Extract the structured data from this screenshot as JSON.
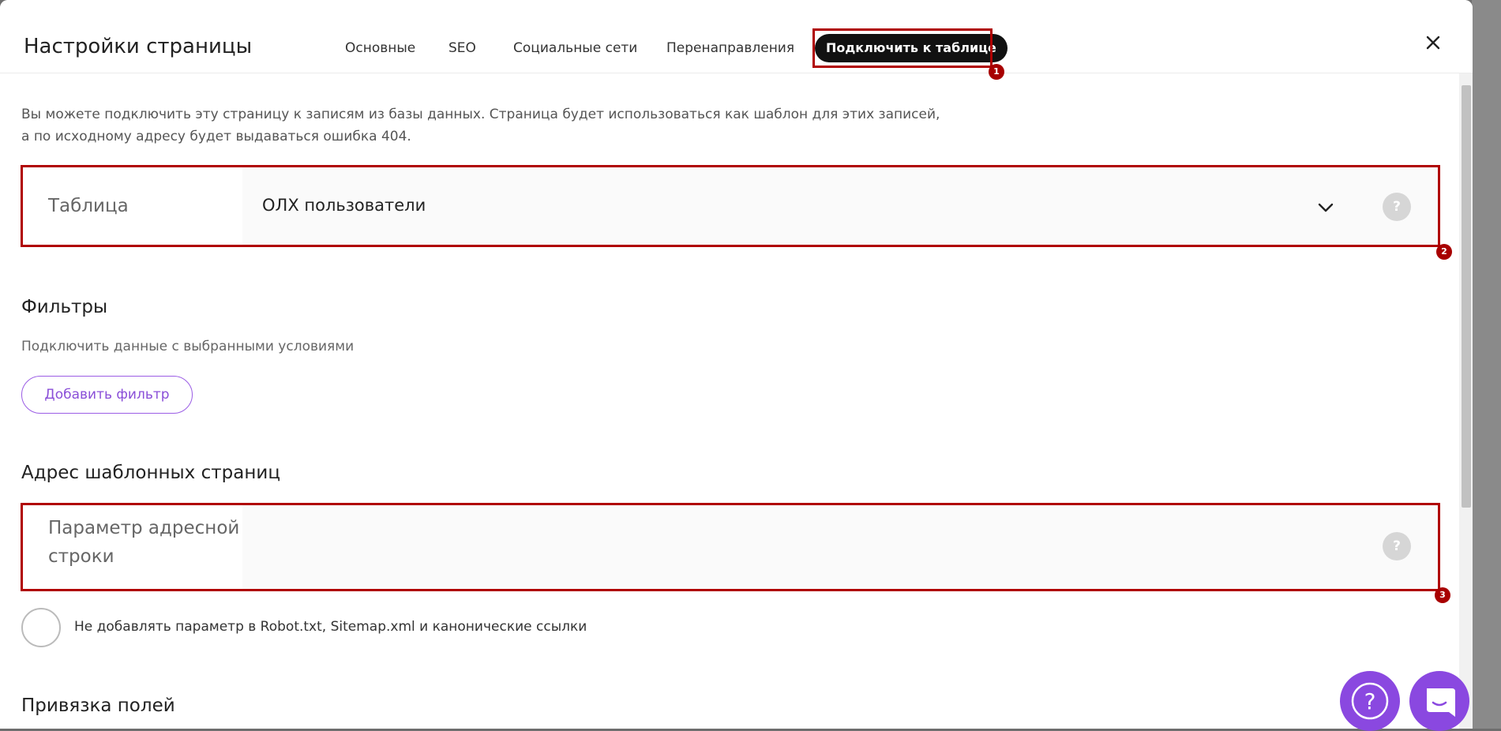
{
  "header": {
    "title": "Настройки страницы",
    "tabs": [
      {
        "label": "Основные"
      },
      {
        "label": "SEO"
      },
      {
        "label": "Социальные сети"
      },
      {
        "label": "Перенаправления"
      },
      {
        "label": "Подключить к таблице",
        "active": true
      }
    ],
    "close_icon": "close-icon"
  },
  "intro": {
    "line1": "Вы можете подключить эту страницу к записям из базы данных. Страница будет использоваться как шаблон для этих записей,",
    "line2": "а по исходному адресу будет выдаваться ошибка 404."
  },
  "table_field": {
    "label": "Таблица",
    "value": "ОЛХ пользователи",
    "help": "?"
  },
  "filters": {
    "title": "Фильтры",
    "subtitle": "Подключить данные с выбранными условиями",
    "add_button": "Добавить фильтр"
  },
  "template_address": {
    "title": "Адрес шаблонных страниц",
    "param_label_line1": "Параметр адресной",
    "param_label_line2": "строки",
    "param_value": "",
    "help": "?",
    "checkbox_label": "Не добавлять параметр в Robot.txt, Sitemap.xml и канонические ссылки",
    "checkbox_checked": false
  },
  "field_binding": {
    "title": "Привязка полей"
  },
  "annotations": [
    "1",
    "2",
    "3"
  ],
  "colors": {
    "accent": "#8a48e0",
    "annotation": "#b00000",
    "active_tab_bg": "#111111"
  },
  "fabs": {
    "help_icon": "question-circle-icon",
    "chat_icon": "chat-bubble-icon"
  }
}
